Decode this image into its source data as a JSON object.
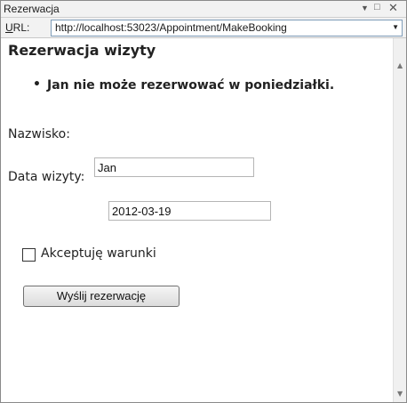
{
  "window": {
    "title": "Rezerwacja",
    "controls": {
      "dropdown": "▼",
      "maximize": "□",
      "close": "✕"
    }
  },
  "urlbar": {
    "label_prefix": "U",
    "label_rest": "RL:",
    "url": "http://localhost:53023/Appointment/MakeBooking",
    "arrow": "▼"
  },
  "page": {
    "heading": "Rezerwacja wizyty",
    "errors": [
      "Jan nie może rezerwować w poniedziałki."
    ],
    "fields": {
      "name_label": "Nazwisko:",
      "name_value": "Jan",
      "date_label": "Data wizyty:",
      "date_value": "2012-03-19"
    },
    "terms": {
      "label": "Akceptuję warunki",
      "checked": false
    },
    "submit_label": "Wyślij rezerwację"
  },
  "scrollbar": {
    "up": "▲",
    "down": "▼"
  }
}
